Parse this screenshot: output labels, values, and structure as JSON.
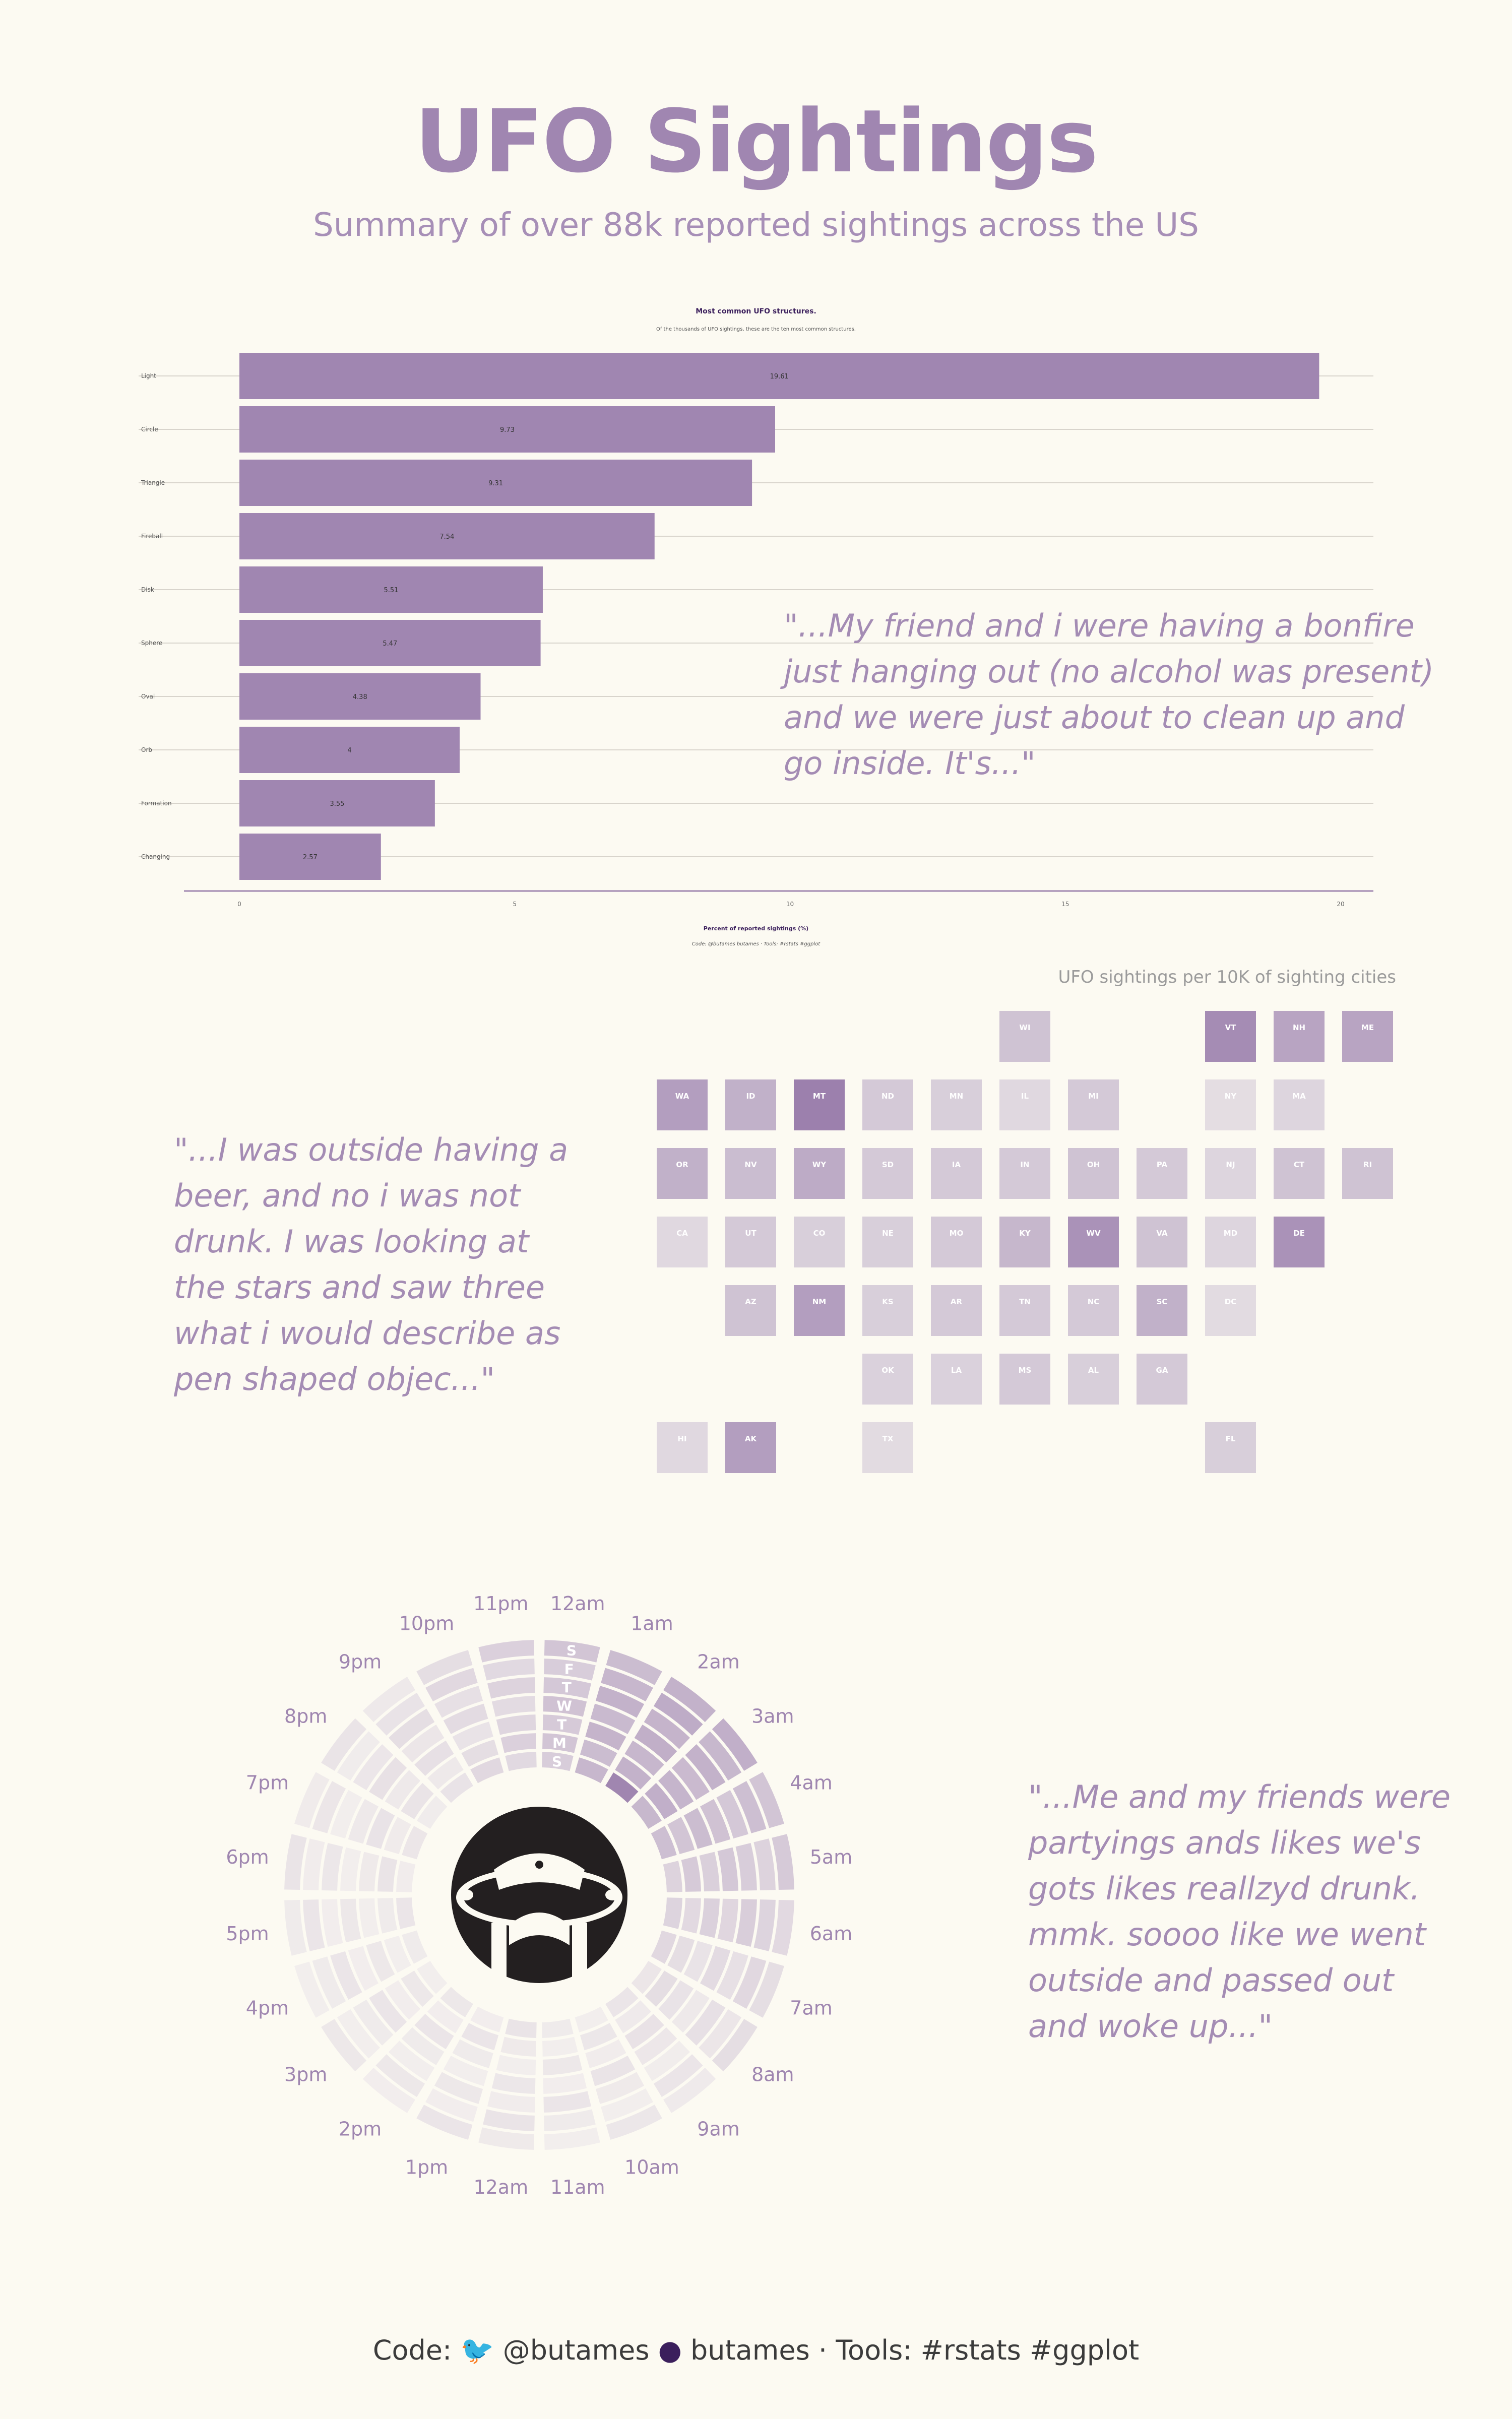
{
  "title": "UFO Sightings",
  "subtitle": "Summary of over 88k reported sightings across the US",
  "quotes": [
    "\"...My friend and i were having a bonfire just hanging out (no alcohol was present) and we were just about to clean up and go inside. It's...\"",
    "\"...I was outside having a beer, and no i was not drunk. I was looking at the stars and saw three what i would describe as pen shaped objec...\"",
    "\"...Me and my friends were partyings ands likes we's gots likes reallzyd drunk. mmk. soooo like we went outside and passed out and woke up...\""
  ],
  "footer": {
    "code_label": "Code:",
    "twitter": "@butames",
    "github": "butames",
    "separator": "·",
    "tools": "Tools: #rstats #ggplot"
  },
  "colors": {
    "background": "#fcfaf2",
    "accent": "#a086b1",
    "dark": "#231f20"
  },
  "chart_data": [
    {
      "type": "bar",
      "orientation": "horizontal",
      "title": "Most common UFO structures.",
      "subtitle": "Of the thousands of UFO sightings, these are the ten most common structures.",
      "xlabel": "Percent of reported sightings (%)",
      "caption": "Code: @butames butames · Tools: #rstats #ggplot",
      "categories": [
        "Light",
        "Circle",
        "Triangle",
        "Fireball",
        "Disk",
        "Sphere",
        "Oval",
        "Orb",
        "Formation",
        "Changing"
      ],
      "values": [
        19.61,
        9.73,
        9.31,
        7.54,
        5.51,
        5.47,
        4.38,
        4,
        3.55,
        2.57
      ],
      "value_labels": [
        "19.61",
        "9.73",
        "9.31",
        "7.54",
        "5.51",
        "5.47",
        "4.38",
        "4",
        "3.55",
        "2.57"
      ],
      "xticks": [
        "0",
        "5",
        "10",
        "15",
        "20"
      ],
      "xlim": [
        0,
        20
      ],
      "grid": true
    },
    {
      "type": "heatmap",
      "title": "UFO sightings per 10K of sighting cities",
      "value_scale": [
        0,
        1
      ],
      "tiles": [
        {
          "state": "WI",
          "row": 0,
          "col": 5,
          "value": 0.3
        },
        {
          "state": "VT",
          "row": 0,
          "col": 8,
          "value": 0.75
        },
        {
          "state": "NH",
          "row": 0,
          "col": 9,
          "value": 0.55
        },
        {
          "state": "ME",
          "row": 0,
          "col": 10,
          "value": 0.55
        },
        {
          "state": "WA",
          "row": 1,
          "col": 0,
          "value": 0.6
        },
        {
          "state": "ID",
          "row": 1,
          "col": 1,
          "value": 0.45
        },
        {
          "state": "MT",
          "row": 1,
          "col": 2,
          "value": 0.85
        },
        {
          "state": "ND",
          "row": 1,
          "col": 3,
          "value": 0.25
        },
        {
          "state": "MN",
          "row": 1,
          "col": 4,
          "value": 0.2
        },
        {
          "state": "IL",
          "row": 1,
          "col": 5,
          "value": 0.12
        },
        {
          "state": "MI",
          "row": 1,
          "col": 6,
          "value": 0.25
        },
        {
          "state": "NY",
          "row": 1,
          "col": 8,
          "value": 0.08
        },
        {
          "state": "MA",
          "row": 1,
          "col": 9,
          "value": 0.15
        },
        {
          "state": "OR",
          "row": 2,
          "col": 0,
          "value": 0.45
        },
        {
          "state": "NV",
          "row": 2,
          "col": 1,
          "value": 0.35
        },
        {
          "state": "WY",
          "row": 2,
          "col": 2,
          "value": 0.5
        },
        {
          "state": "SD",
          "row": 2,
          "col": 3,
          "value": 0.25
        },
        {
          "state": "IA",
          "row": 2,
          "col": 4,
          "value": 0.25
        },
        {
          "state": "IN",
          "row": 2,
          "col": 5,
          "value": 0.25
        },
        {
          "state": "OH",
          "row": 2,
          "col": 6,
          "value": 0.3
        },
        {
          "state": "PA",
          "row": 2,
          "col": 7,
          "value": 0.25
        },
        {
          "state": "NJ",
          "row": 2,
          "col": 8,
          "value": 0.15
        },
        {
          "state": "CT",
          "row": 2,
          "col": 9,
          "value": 0.3
        },
        {
          "state": "RI",
          "row": 2,
          "col": 10,
          "value": 0.3
        },
        {
          "state": "CA",
          "row": 3,
          "col": 0,
          "value": 0.12
        },
        {
          "state": "UT",
          "row": 3,
          "col": 1,
          "value": 0.25
        },
        {
          "state": "CO",
          "row": 3,
          "col": 2,
          "value": 0.2
        },
        {
          "state": "NE",
          "row": 3,
          "col": 3,
          "value": 0.2
        },
        {
          "state": "MO",
          "row": 3,
          "col": 4,
          "value": 0.25
        },
        {
          "state": "KY",
          "row": 3,
          "col": 5,
          "value": 0.4
        },
        {
          "state": "WV",
          "row": 3,
          "col": 6,
          "value": 0.7
        },
        {
          "state": "VA",
          "row": 3,
          "col": 7,
          "value": 0.3
        },
        {
          "state": "MD",
          "row": 3,
          "col": 8,
          "value": 0.15
        },
        {
          "state": "DE",
          "row": 3,
          "col": 9,
          "value": 0.7
        },
        {
          "state": "AZ",
          "row": 4,
          "col": 1,
          "value": 0.3
        },
        {
          "state": "NM",
          "row": 4,
          "col": 2,
          "value": 0.6
        },
        {
          "state": "KS",
          "row": 4,
          "col": 3,
          "value": 0.2
        },
        {
          "state": "AR",
          "row": 4,
          "col": 4,
          "value": 0.25
        },
        {
          "state": "TN",
          "row": 4,
          "col": 5,
          "value": 0.25
        },
        {
          "state": "NC",
          "row": 4,
          "col": 6,
          "value": 0.25
        },
        {
          "state": "SC",
          "row": 4,
          "col": 7,
          "value": 0.45
        },
        {
          "state": "DC",
          "row": 4,
          "col": 8,
          "value": 0.1
        },
        {
          "state": "OK",
          "row": 5,
          "col": 3,
          "value": 0.18
        },
        {
          "state": "LA",
          "row": 5,
          "col": 4,
          "value": 0.18
        },
        {
          "state": "MS",
          "row": 5,
          "col": 5,
          "value": 0.25
        },
        {
          "state": "AL",
          "row": 5,
          "col": 6,
          "value": 0.2
        },
        {
          "state": "GA",
          "row": 5,
          "col": 7,
          "value": 0.25
        },
        {
          "state": "HI",
          "row": 6,
          "col": 0,
          "value": 0.12
        },
        {
          "state": "AK",
          "row": 6,
          "col": 1,
          "value": 0.6
        },
        {
          "state": "TX",
          "row": 6,
          "col": 3,
          "value": 0.1
        },
        {
          "state": "FL",
          "row": 6,
          "col": 8,
          "value": 0.2
        }
      ]
    },
    {
      "type": "heatmap",
      "coordinate": "polar",
      "hours": [
        "12am",
        "1am",
        "2am",
        "3am",
        "4am",
        "5am",
        "6am",
        "7am",
        "8am",
        "9am",
        "10am",
        "11am",
        "12am",
        "1pm",
        "2pm",
        "3pm",
        "4pm",
        "5pm",
        "6pm",
        "7pm",
        "8pm",
        "9pm",
        "10pm",
        "11pm"
      ],
      "days": [
        "S",
        "F",
        "T",
        "W",
        "T",
        "M",
        "S"
      ],
      "hour_intensity": [
        0.35,
        0.5,
        0.55,
        0.52,
        0.4,
        0.3,
        0.24,
        0.15,
        0.1,
        0.06,
        0.04,
        0.03,
        0.04,
        0.03,
        0.03,
        0.03,
        0.03,
        0.03,
        0.04,
        0.05,
        0.07,
        0.1,
        0.15,
        0.22
      ]
    }
  ]
}
